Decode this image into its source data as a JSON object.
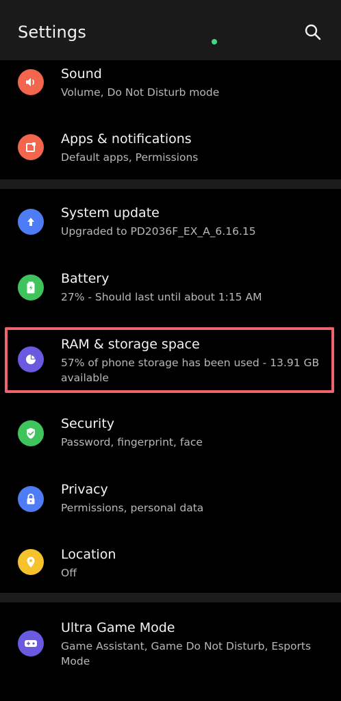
{
  "header": {
    "title": "Settings",
    "search_icon": "search-icon"
  },
  "colors": {
    "sound": "#f2664e",
    "apps": "#f2664e",
    "system_update": "#4d7cf5",
    "battery": "#3fc45d",
    "ram": "#6a5ae0",
    "security": "#3fc45d",
    "privacy": "#4d7cf5",
    "location": "#f5c22b",
    "game": "#6a5ae0",
    "highlight": "#f0646e"
  },
  "items": [
    {
      "title": "Sound",
      "subtitle": "Volume, Do Not Disturb mode",
      "icon": "speaker-icon"
    },
    {
      "title": "Apps & notifications",
      "subtitle": "Default apps, Permissions",
      "icon": "apps-icon"
    },
    {
      "title": "System update",
      "subtitle": "Upgraded to PD2036F_EX_A_6.16.15",
      "icon": "arrow-up-icon"
    },
    {
      "title": "Battery",
      "subtitle": "27% - Should last until about 1:15 AM",
      "icon": "battery-icon"
    },
    {
      "title": "RAM & storage space",
      "subtitle": "57% of phone storage has been used - 13.91 GB available",
      "icon": "pie-chart-icon"
    },
    {
      "title": "Security",
      "subtitle": "Password, fingerprint, face",
      "icon": "shield-icon"
    },
    {
      "title": "Privacy",
      "subtitle": "Permissions, personal data",
      "icon": "lock-icon"
    },
    {
      "title": "Location",
      "subtitle": "Off",
      "icon": "location-pin-icon"
    },
    {
      "title": "Ultra Game Mode",
      "subtitle": "Game Assistant, Game Do Not Disturb, Esports Mode",
      "icon": "gamepad-icon"
    }
  ]
}
